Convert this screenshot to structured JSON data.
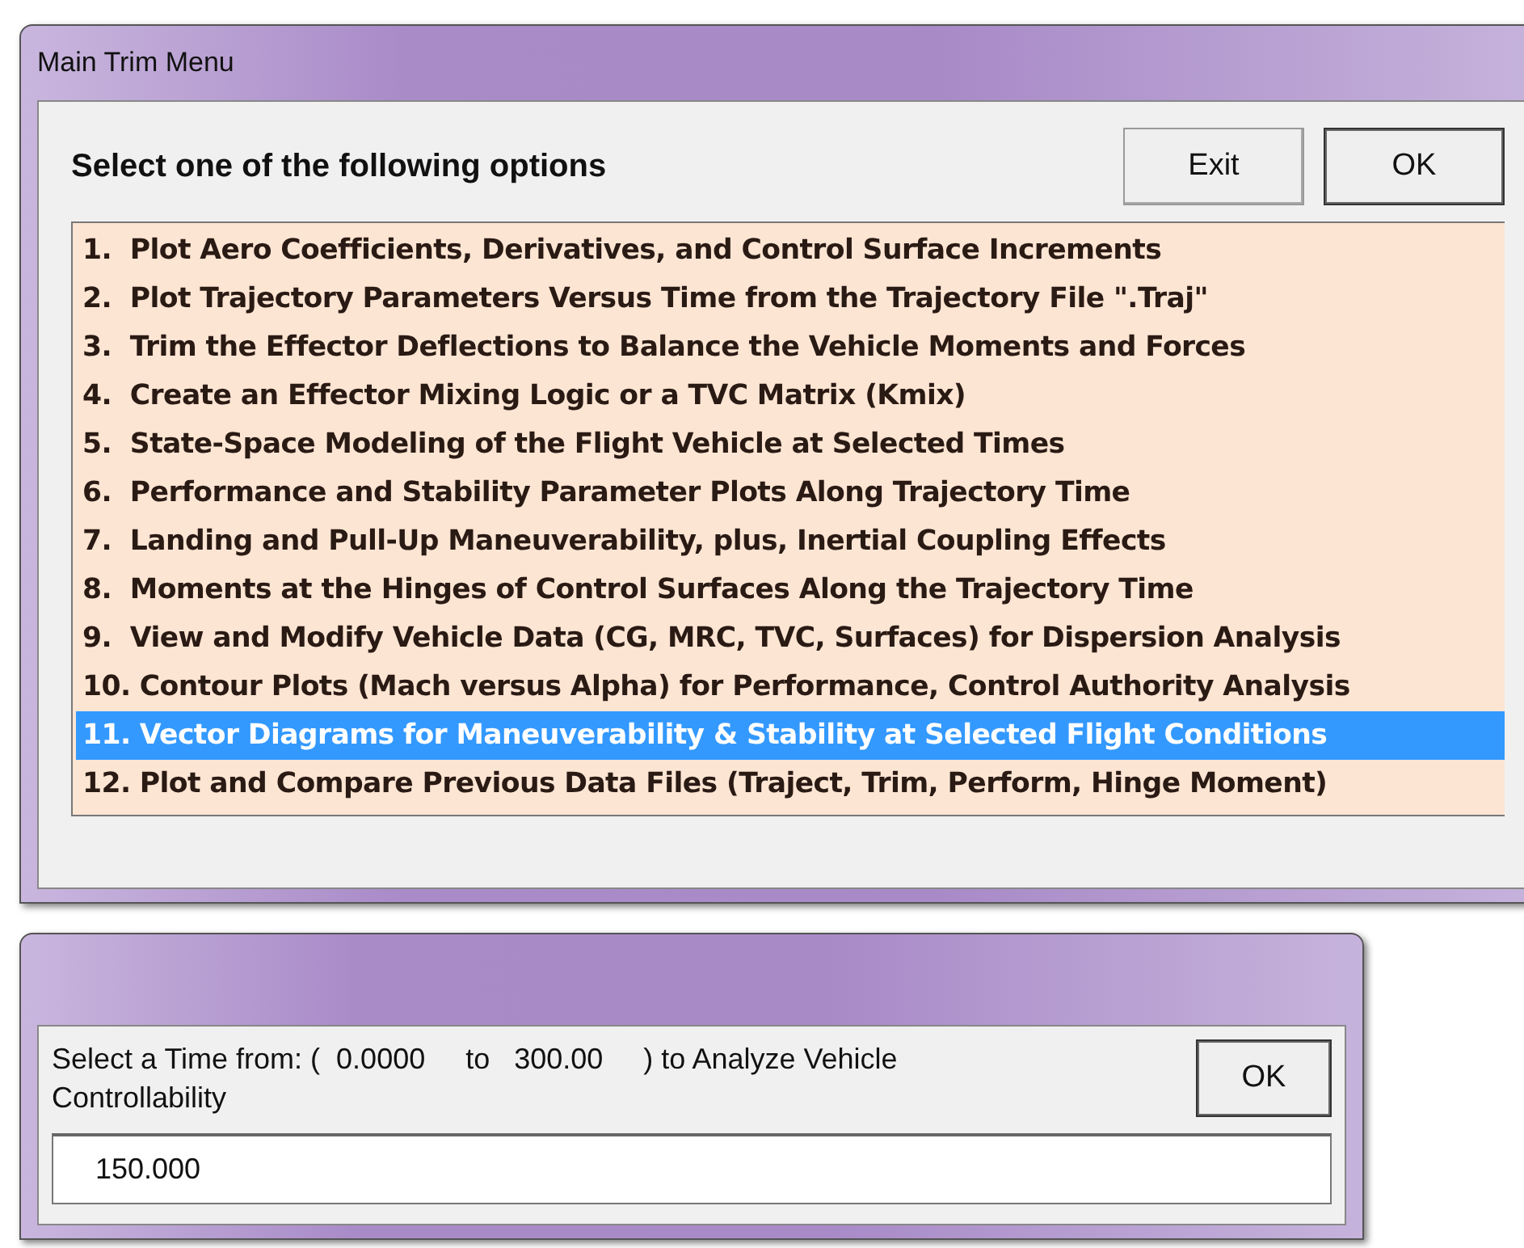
{
  "main_window": {
    "title": "Main Trim Menu",
    "heading": "Select one of the following options",
    "buttons": [
      {
        "label": "Exit",
        "kind": "plain"
      },
      {
        "label": "OK",
        "kind": "default"
      }
    ],
    "options": [
      {
        "label": "1.  Plot Aero Coefficients, Derivatives, and Control Surface Increments",
        "selected": false
      },
      {
        "label": "2.  Plot Trajectory Parameters Versus Time from the Trajectory File \".Traj\"",
        "selected": false
      },
      {
        "label": "3.  Trim the Effector Deflections to Balance the Vehicle Moments and Forces",
        "selected": false
      },
      {
        "label": "4.  Create an Effector Mixing Logic or a TVC Matrix (Kmix)",
        "selected": false
      },
      {
        "label": "5.  State-Space Modeling of the Flight Vehicle at Selected Times",
        "selected": false
      },
      {
        "label": "6.  Performance and Stability Parameter Plots Along Trajectory Time",
        "selected": false
      },
      {
        "label": "7.  Landing and Pull-Up Maneuverability, plus, Inertial Coupling Effects",
        "selected": false
      },
      {
        "label": "8.  Moments at the Hinges of Control Surfaces Along the Trajectory Time",
        "selected": false
      },
      {
        "label": "9.  View and Modify Vehicle Data (CG, MRC, TVC, Surfaces) for Dispersion Analysis",
        "selected": false
      },
      {
        "label": "10. Contour Plots (Mach versus Alpha) for Performance, Control Authority Analysis",
        "selected": false
      },
      {
        "label": "11. Vector Diagrams for Maneuverability & Stability at Selected Flight Conditions",
        "selected": true
      },
      {
        "label": "12. Plot and Compare Previous Data Files (Traject, Trim, Perform, Hinge Moment)",
        "selected": false
      }
    ]
  },
  "time_dialog": {
    "prompt": "Select a Time from: (  0.0000     to   300.00     ) to Analyze Vehicle Controllability",
    "button": "OK",
    "value": "150.000"
  }
}
